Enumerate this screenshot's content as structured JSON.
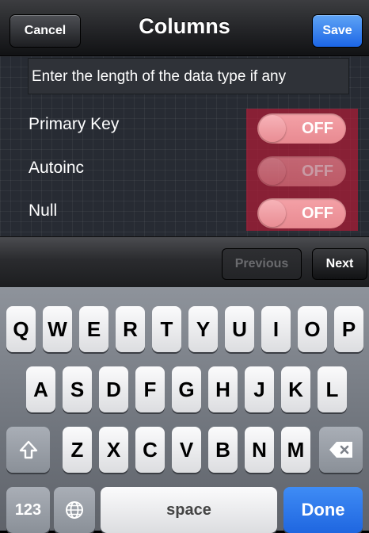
{
  "navbar": {
    "cancel_label": "Cancel",
    "title": "Columns",
    "save_label": "Save"
  },
  "form": {
    "length_field_value": "Enter the length of the data type if any",
    "rows": [
      {
        "label": "Primary Key",
        "toggle_text": "OFF"
      },
      {
        "label": "Autoinc",
        "toggle_text": "OFF"
      },
      {
        "label": "Null",
        "toggle_text": "OFF"
      }
    ]
  },
  "accessory": {
    "previous_label": "Previous",
    "next_label": "Next"
  },
  "keyboard": {
    "row1": [
      "Q",
      "W",
      "E",
      "R",
      "T",
      "Y",
      "U",
      "I",
      "O",
      "P"
    ],
    "row2": [
      "A",
      "S",
      "D",
      "F",
      "G",
      "H",
      "J",
      "K",
      "L"
    ],
    "row3": [
      "Z",
      "X",
      "C",
      "V",
      "B",
      "N",
      "M"
    ],
    "numbers_label": "123",
    "space_label": "space",
    "done_label": "Done"
  },
  "colors": {
    "accent": "#1f66e0",
    "highlight": "#aa1e37",
    "toggle_off": "#ee949b"
  }
}
